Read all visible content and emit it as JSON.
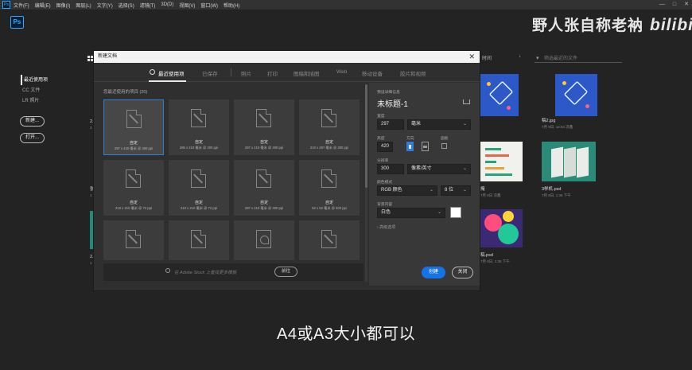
{
  "menubar": {
    "app_icon": "Ps",
    "items": [
      "文件(F)",
      "编辑(E)",
      "图像(I)",
      "图层(L)",
      "文字(Y)",
      "选择(S)",
      "滤镜(T)",
      "3D(D)",
      "视图(V)",
      "窗口(W)",
      "帮助(H)"
    ],
    "window_controls": [
      "—",
      "□",
      "✕"
    ]
  },
  "app_logo": "Ps",
  "watermark": {
    "name": "野人张自称老衲",
    "brand": "bilibili"
  },
  "home": {
    "nav": [
      "最近使用项",
      "CC 文件",
      "LR 照片"
    ],
    "new_button": "新建...",
    "open_button": "打开..."
  },
  "background": {
    "sort_label": "时间",
    "sort_arrow": "↓",
    "search_placeholder": "筛选最近的文件",
    "files": [
      {
        "name": "2.",
        "meta": "3"
      },
      {
        "name": "张",
        "meta": "1"
      },
      {
        "name": "2.",
        "meta": "1"
      },
      {
        "name": "",
        "meta": ""
      },
      {
        "name": "稿2.jpg",
        "meta": "7月 9日, 12:54 凉鑫"
      },
      {
        "name": "掩",
        "meta": "7月 8日 凉鑫"
      },
      {
        "name": "3样机.psd",
        "meta": "7月 8日, 1:36 下午"
      },
      {
        "name": "稿.psd",
        "meta": "7月 8日, 1:35 下午"
      }
    ]
  },
  "dialog": {
    "title": "新建文档",
    "close_icon": "close-icon",
    "tabs": [
      "最近使用项",
      "已保存",
      "照片",
      "打印",
      "图稿和插图",
      "Web",
      "移动设备",
      "胶片和视频"
    ],
    "recent_heading": "您最近使用的项目 (20)",
    "presets": [
      {
        "name": "自定",
        "size": "297 x 420 毫米 @ 300 ppi"
      },
      {
        "name": "自定",
        "size": "285 x 210 毫米 @ 300 ppi"
      },
      {
        "name": "自定",
        "size": "297 x 210 毫米 @ 300 ppi"
      },
      {
        "name": "自定",
        "size": "210 x 297 毫米 @ 300 ppi"
      },
      {
        "name": "自定",
        "size": "210 x 210 毫米 @ 72 ppi"
      },
      {
        "name": "自定",
        "size": "210 x 210 毫米 @ 72 ppi"
      },
      {
        "name": "自定",
        "size": "297 x 210 毫米 @ 300 ppi"
      },
      {
        "name": "自定",
        "size": "52 x 52 毫米 @ 300 ppi"
      },
      {
        "name": "",
        "size": ""
      },
      {
        "name": "",
        "size": ""
      },
      {
        "name": "",
        "size": ""
      },
      {
        "name": "",
        "size": ""
      }
    ],
    "stock_placeholder": "在 Adobe Stock 上查找更多模板",
    "stock_go": "前往",
    "details": {
      "heading": "预设详细信息",
      "doc_name": "未标题-1",
      "width_label": "宽度",
      "width_value": "297",
      "width_unit": "毫米",
      "height_label": "高度",
      "height_value": "420",
      "orientation_label": "方向",
      "artboard_label": "画板",
      "resolution_label": "分辨率",
      "resolution_value": "300",
      "resolution_unit": "像素/英寸",
      "color_mode_label": "颜色模式",
      "color_mode_value": "RGB 颜色",
      "bit_depth": "8 位",
      "background_label": "背景内容",
      "background_value": "白色",
      "background_swatch": "#ffffff",
      "advanced": "高级选项"
    },
    "create_button": "创建",
    "close_button": "关闭"
  },
  "subtitle": "A4或A3大小都可以",
  "colors": {
    "accent": "#1473e6",
    "selection": "#2f7fd7",
    "ps_blue": "#31a8ff"
  }
}
